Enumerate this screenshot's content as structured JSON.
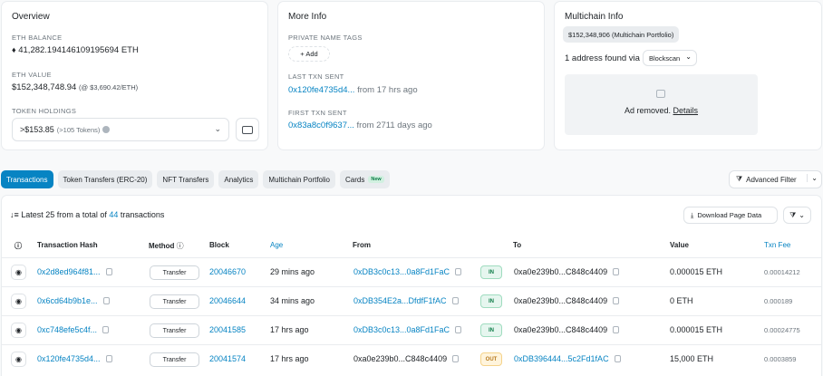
{
  "overview": {
    "title": "Overview",
    "eth_balance_label": "ETH BALANCE",
    "eth_balance_value": "41,282.194146109195694 ETH",
    "eth_value_label": "ETH VALUE",
    "eth_value_amount": "$152,348,748.94",
    "eth_value_price": "(@ $3,690.42/ETH)",
    "token_holdings_label": "TOKEN HOLDINGS",
    "token_holdings_value": ">$153.85",
    "token_holdings_count": "(>105 Tokens)"
  },
  "more_info": {
    "title": "More Info",
    "private_tags_label": "PRIVATE NAME TAGS",
    "add_label": "+ Add",
    "last_txn_label": "LAST TXN SENT",
    "last_txn_hash": "0x120fe4735d4...",
    "last_txn_time": "from 17 hrs ago",
    "first_txn_label": "FIRST TXN SENT",
    "first_txn_hash": "0x83a8c0f9637...",
    "first_txn_time": "from 2711 days ago"
  },
  "multichain": {
    "title": "Multichain Info",
    "portfolio_badge": "$152,348,906 (Multichain Portfolio)",
    "address_found": "1 address found via",
    "blockscan_label": "Blockscan",
    "ad_text": "Ad removed.",
    "ad_link": "Details"
  },
  "tabs": [
    {
      "label": "Transactions"
    },
    {
      "label": "Token Transfers (ERC-20)"
    },
    {
      "label": "NFT Transfers"
    },
    {
      "label": "Analytics"
    },
    {
      "label": "Multichain Portfolio"
    },
    {
      "label": "Cards",
      "badge": "New"
    }
  ],
  "advanced_filter_label": "Advanced Filter",
  "summary": {
    "prefix": "Latest 25 from a total of",
    "count": "44",
    "suffix": "transactions"
  },
  "download_label": "Download Page Data",
  "columns": {
    "hash": "Transaction Hash",
    "method": "Method",
    "block": "Block",
    "age": "Age",
    "from": "From",
    "to": "To",
    "value": "Value",
    "fee": "Txn Fee"
  },
  "rows": [
    {
      "hash": "0x2d8ed964f81...",
      "method": "Transfer",
      "block": "20046670",
      "age": "29 mins ago",
      "from": "0xDB3c0c13...0a8Fd1FaC",
      "dir": "IN",
      "to": "0xa0e239b0...C848c4409",
      "value": "0.000015 ETH",
      "fee": "0.00014212"
    },
    {
      "hash": "0x6cd64b9b1e...",
      "method": "Transfer",
      "block": "20046644",
      "age": "34 mins ago",
      "from": "0xDB354E2a...DfdfF1fAC",
      "dir": "IN",
      "to": "0xa0e239b0...C848c4409",
      "value": "0 ETH",
      "fee": "0.000189"
    },
    {
      "hash": "0xc748efe5c4f...",
      "method": "Transfer",
      "block": "20041585",
      "age": "17 hrs ago",
      "from": "0xDB3c0c13...0a8Fd1FaC",
      "dir": "IN",
      "to": "0xa0e239b0...C848c4409",
      "value": "0.000015 ETH",
      "fee": "0.00024775"
    },
    {
      "hash": "0x120fe4735d4...",
      "method": "Transfer",
      "block": "20041574",
      "age": "17 hrs ago",
      "from": "0xa0e239b0...C848c4409",
      "dir": "OUT",
      "to": "0xDB396444...5c2Fd1fAC",
      "value": "15,000 ETH",
      "fee": "0.0003859"
    }
  ]
}
